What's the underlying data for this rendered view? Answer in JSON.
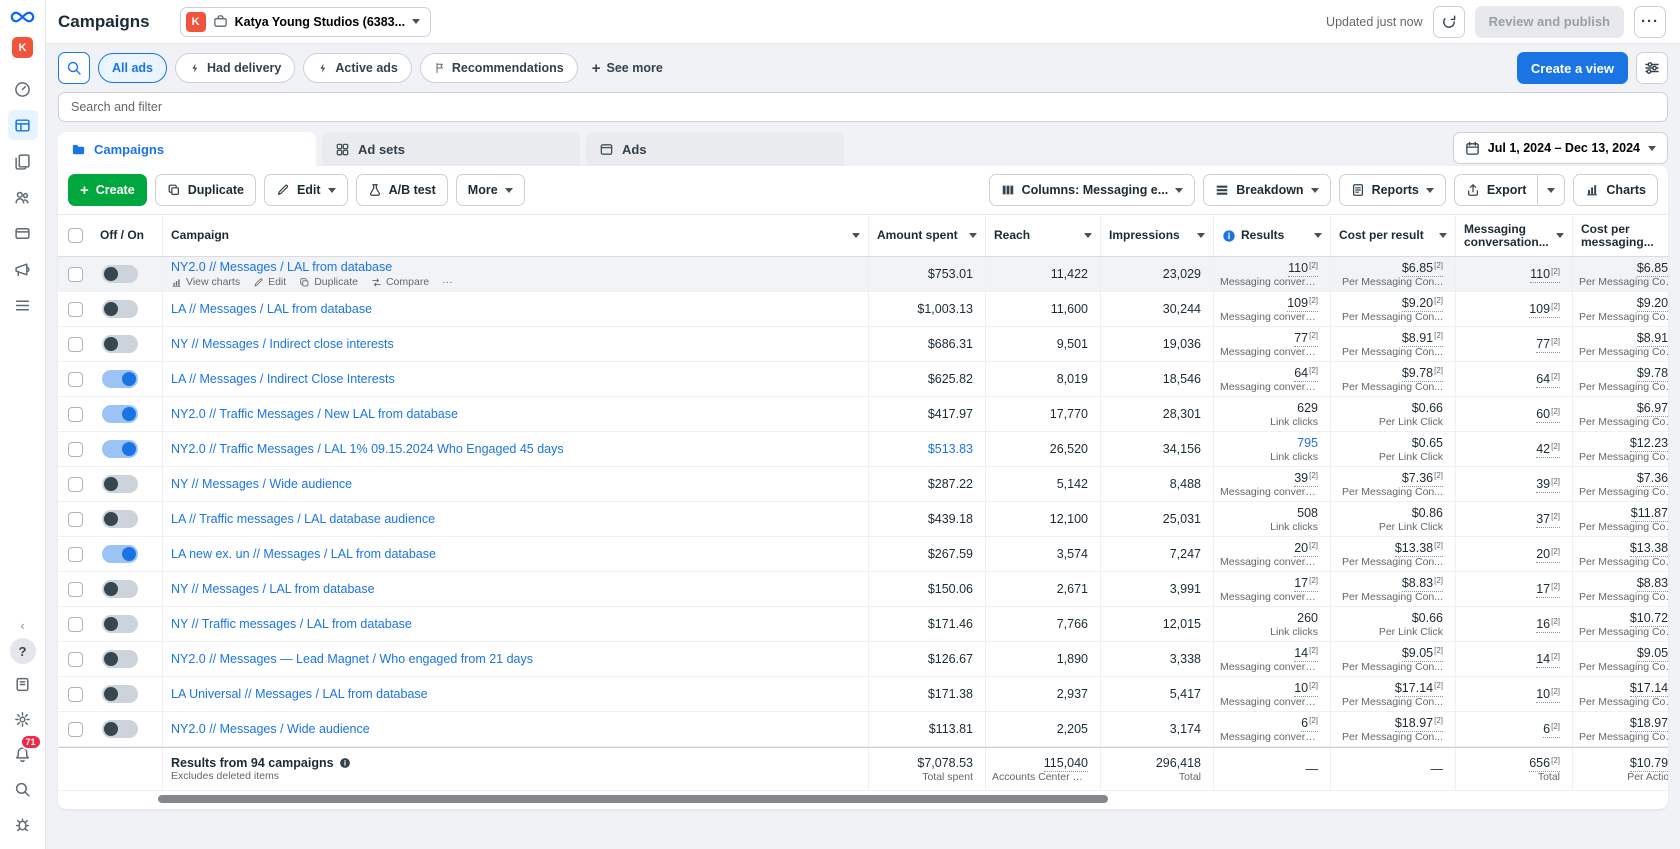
{
  "colors": {
    "accent_blue": "#1b74e4",
    "create_green": "#00a63e",
    "badge_red": "#f02849",
    "avatar_orange": "#f0543c",
    "meta_blue": "#0866ff"
  },
  "sidebar": {
    "help": "?",
    "notification_count": "71"
  },
  "topbar": {
    "title": "Campaigns",
    "account_initial": "K",
    "account_name": "Katya Young Studios (6383...",
    "updated": "Updated just now",
    "review_publish": "Review and publish"
  },
  "filter_bar": {
    "search_pills": [
      {
        "label": "All ads",
        "active": true
      },
      {
        "label": "Had delivery",
        "active": false
      },
      {
        "label": "Active ads",
        "active": false
      },
      {
        "label": "Recommendations",
        "active": false
      }
    ],
    "see_more": "See more",
    "create_view": "Create a view"
  },
  "search": {
    "placeholder": "Search and filter"
  },
  "tabs": {
    "campaigns": "Campaigns",
    "ad_sets": "Ad sets",
    "ads": "Ads"
  },
  "date_range": "Jul 1, 2024 – Dec 13, 2024",
  "toolbar": {
    "create": "Create",
    "duplicate": "Duplicate",
    "edit": "Edit",
    "ab_test": "A/B test",
    "more": "More",
    "columns": "Columns: Messaging e...",
    "breakdown": "Breakdown",
    "reports": "Reports",
    "export": "Export",
    "charts": "Charts"
  },
  "table": {
    "footnote": "[2]",
    "headers": {
      "off_on": "Off / On",
      "campaign": "Campaign",
      "amount_spent": "Amount spent",
      "reach": "Reach",
      "impressions": "Impressions",
      "results": "Results",
      "cost_per_result": "Cost per result",
      "messaging_conversations": "Messaging conversation...",
      "cost_per_messaging": "Cost per messaging..."
    },
    "row_actions": [
      "View charts",
      "Edit",
      "Duplicate",
      "Compare"
    ],
    "rows": [
      {
        "name": "NY2.0 // Messages / LAL from database",
        "on": false,
        "spent": "$753.01",
        "spent_link": false,
        "reach": "11,422",
        "impr": "23,029",
        "results": "110",
        "res_sup": true,
        "res_link": false,
        "res_label": "Messaging convers...",
        "cost": "$6.85",
        "cost_sup": true,
        "cost_label": "Per Messaging Con...",
        "msg": "110",
        "cost_msg": "$6.85",
        "cost_msg_label": "Per Messaging Con..."
      },
      {
        "name": "LA // Messages / LAL from database",
        "on": false,
        "spent": "$1,003.13",
        "spent_link": false,
        "reach": "11,600",
        "impr": "30,244",
        "results": "109",
        "res_sup": true,
        "res_link": false,
        "res_label": "Messaging convers...",
        "cost": "$9.20",
        "cost_sup": true,
        "cost_label": "Per Messaging Con...",
        "msg": "109",
        "cost_msg": "$9.20",
        "cost_msg_label": "Per Messaging Con..."
      },
      {
        "name": "NY // Messages / Indirect close interests",
        "on": false,
        "spent": "$686.31",
        "spent_link": false,
        "reach": "9,501",
        "impr": "19,036",
        "results": "77",
        "res_sup": true,
        "res_link": false,
        "res_label": "Messaging convers...",
        "cost": "$8.91",
        "cost_sup": true,
        "cost_label": "Per Messaging Con...",
        "msg": "77",
        "cost_msg": "$8.91",
        "cost_msg_label": "Per Messaging Con..."
      },
      {
        "name": "LA // Messages / Indirect Close Interests",
        "on": true,
        "spent": "$625.82",
        "spent_link": false,
        "reach": "8,019",
        "impr": "18,546",
        "results": "64",
        "res_sup": true,
        "res_link": false,
        "res_label": "Messaging convers...",
        "cost": "$9.78",
        "cost_sup": true,
        "cost_label": "Per Messaging Con...",
        "msg": "64",
        "cost_msg": "$9.78",
        "cost_msg_label": "Per Messaging Con..."
      },
      {
        "name": "NY2.0 // Traffic Messages / New LAL from database",
        "on": true,
        "spent": "$417.97",
        "spent_link": false,
        "reach": "17,770",
        "impr": "28,301",
        "results": "629",
        "res_sup": false,
        "res_link": false,
        "res_label": "Link clicks",
        "cost": "$0.66",
        "cost_sup": false,
        "cost_label": "Per Link Click",
        "msg": "60",
        "cost_msg": "$6.97",
        "cost_msg_label": "Per Messaging Con..."
      },
      {
        "name": "NY2.0 // Traffic Messages / LAL 1% 09.15.2024 Who Engaged 45 days",
        "on": true,
        "spent": "$513.83",
        "spent_link": true,
        "reach": "26,520",
        "impr": "34,156",
        "results": "795",
        "res_sup": false,
        "res_link": true,
        "res_label": "Link clicks",
        "cost": "$0.65",
        "cost_sup": false,
        "cost_label": "Per Link Click",
        "msg": "42",
        "cost_msg": "$12.23",
        "cost_msg_label": "Per Messaging Con..."
      },
      {
        "name": "NY // Messages / Wide audience",
        "on": false,
        "spent": "$287.22",
        "spent_link": false,
        "reach": "5,142",
        "impr": "8,488",
        "results": "39",
        "res_sup": true,
        "res_link": false,
        "res_label": "Messaging convers...",
        "cost": "$7.36",
        "cost_sup": true,
        "cost_label": "Per Messaging Con...",
        "msg": "39",
        "cost_msg": "$7.36",
        "cost_msg_label": "Per Messaging Con..."
      },
      {
        "name": "LA // Traffic messages / LAL database audience",
        "on": false,
        "spent": "$439.18",
        "spent_link": false,
        "reach": "12,100",
        "impr": "25,031",
        "results": "508",
        "res_sup": false,
        "res_link": false,
        "res_label": "Link clicks",
        "cost": "$0.86",
        "cost_sup": false,
        "cost_label": "Per Link Click",
        "msg": "37",
        "cost_msg": "$11.87",
        "cost_msg_label": "Per Messaging Con..."
      },
      {
        "name": "LA new ex. un // Messages / LAL from database",
        "on": true,
        "spent": "$267.59",
        "spent_link": false,
        "reach": "3,574",
        "impr": "7,247",
        "results": "20",
        "res_sup": true,
        "res_link": false,
        "res_label": "Messaging convers...",
        "cost": "$13.38",
        "cost_sup": true,
        "cost_label": "Per Messaging Con...",
        "msg": "20",
        "cost_msg": "$13.38",
        "cost_msg_label": "Per Messaging Con..."
      },
      {
        "name": "NY // Messages / LAL from database",
        "on": false,
        "spent": "$150.06",
        "spent_link": false,
        "reach": "2,671",
        "impr": "3,991",
        "results": "17",
        "res_sup": true,
        "res_link": false,
        "res_label": "Messaging convers...",
        "cost": "$8.83",
        "cost_sup": true,
        "cost_label": "Per Messaging Con...",
        "msg": "17",
        "cost_msg": "$8.83",
        "cost_msg_label": "Per Messaging Con..."
      },
      {
        "name": "NY // Traffic messages / LAL from database",
        "on": false,
        "spent": "$171.46",
        "spent_link": false,
        "reach": "7,766",
        "impr": "12,015",
        "results": "260",
        "res_sup": false,
        "res_link": false,
        "res_label": "Link clicks",
        "cost": "$0.66",
        "cost_sup": false,
        "cost_label": "Per Link Click",
        "msg": "16",
        "cost_msg": "$10.72",
        "cost_msg_label": "Per Messaging Con..."
      },
      {
        "name": "NY2.0 // Messages — Lead Magnet / Who engaged from 21 days",
        "on": false,
        "spent": "$126.67",
        "spent_link": false,
        "reach": "1,890",
        "impr": "3,338",
        "results": "14",
        "res_sup": true,
        "res_link": false,
        "res_label": "Messaging convers...",
        "cost": "$9.05",
        "cost_sup": true,
        "cost_label": "Per Messaging Con...",
        "msg": "14",
        "cost_msg": "$9.05",
        "cost_msg_label": "Per Messaging Con..."
      },
      {
        "name": "LA Universal // Messages / LAL from database",
        "on": false,
        "spent": "$171.38",
        "spent_link": false,
        "reach": "2,937",
        "impr": "5,417",
        "results": "10",
        "res_sup": true,
        "res_link": false,
        "res_label": "Messaging convers...",
        "cost": "$17.14",
        "cost_sup": true,
        "cost_label": "Per Messaging Con...",
        "msg": "10",
        "cost_msg": "$17.14",
        "cost_msg_label": "Per Messaging Con..."
      },
      {
        "name": "NY2.0 // Messages / Wide audience",
        "on": false,
        "spent": "$113.81",
        "spent_link": false,
        "reach": "2,205",
        "impr": "3,174",
        "results": "6",
        "res_sup": true,
        "res_link": false,
        "res_label": "Messaging convers...",
        "cost": "$18.97",
        "cost_sup": true,
        "cost_label": "Per Messaging Con...",
        "msg": "6",
        "cost_msg": "$18.97",
        "cost_msg_label": "Per Messaging Con..."
      }
    ],
    "footer": {
      "summary": "Results from 94 campaigns",
      "note": "Excludes deleted items",
      "spent": "$7,078.53",
      "spent_label": "Total spent",
      "reach": "115,040",
      "reach_label": "Accounts Center acc...",
      "impressions": "296,418",
      "impressions_label": "Total",
      "results": "—",
      "cost_per_result": "—",
      "messaging": "656",
      "messaging_label": "Total",
      "cost_per_messaging": "$10.79",
      "cost_per_messaging_label": "Per Actio..."
    }
  }
}
